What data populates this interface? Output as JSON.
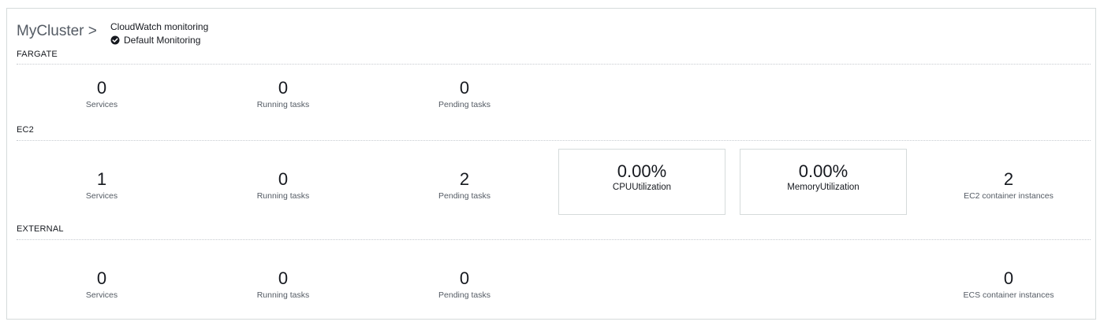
{
  "header": {
    "cluster_name": "MyCluster",
    "chevron": ">",
    "monitoring_title": "CloudWatch monitoring",
    "monitoring_status": "Default Monitoring",
    "status_icon": "check-circle-icon"
  },
  "sections": {
    "fargate": {
      "label": "FARGATE",
      "services": {
        "value": "0",
        "label": "Services"
      },
      "running": {
        "value": "0",
        "label": "Running tasks"
      },
      "pending": {
        "value": "0",
        "label": "Pending tasks"
      }
    },
    "ec2": {
      "label": "EC2",
      "services": {
        "value": "1",
        "label": "Services"
      },
      "running": {
        "value": "0",
        "label": "Running tasks"
      },
      "pending": {
        "value": "2",
        "label": "Pending tasks"
      },
      "cpu": {
        "value": "0.00%",
        "label": "CPUUtilization"
      },
      "memory": {
        "value": "0.00%",
        "label": "MemoryUtilization"
      },
      "instances": {
        "value": "2",
        "label": "EC2 container instances"
      }
    },
    "external": {
      "label": "EXTERNAL",
      "services": {
        "value": "0",
        "label": "Services"
      },
      "running": {
        "value": "0",
        "label": "Running tasks"
      },
      "pending": {
        "value": "0",
        "label": "Pending tasks"
      },
      "instances": {
        "value": "0",
        "label": "ECS container instances"
      }
    }
  }
}
